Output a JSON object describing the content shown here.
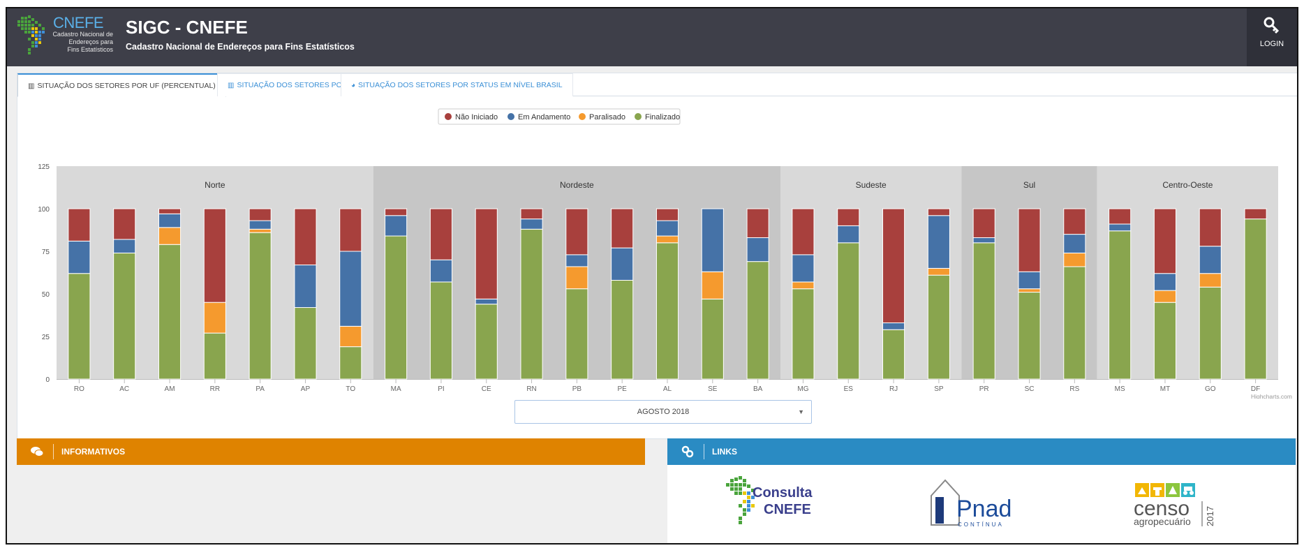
{
  "header": {
    "logo_word": "CNEFE",
    "logo_sub_lines": [
      "Cadastro Nacional de",
      "Endereços para",
      "Fins Estatísticos"
    ],
    "title": "SIGC - CNEFE",
    "subtitle": "Cadastro Nacional de Endereços para Fins Estatísticos",
    "login_icon": "key-icon",
    "login_label": "LOGIN"
  },
  "tabs": [
    {
      "label": "SITUAÇÃO DOS SETORES POR UF (PERCENTUAL)",
      "icon": "bar-chart-icon",
      "active": true
    },
    {
      "label": "SITUAÇÃO DOS SETORES POR UF",
      "icon": "bar-chart-icon",
      "active": false
    },
    {
      "label": "SITUAÇÃO DOS SETORES POR STATUS EM NÍVEL BRASIL",
      "icon": "pie-chart-icon",
      "active": false
    }
  ],
  "chart_data": {
    "type": "bar",
    "stacked": true,
    "categories": [
      "RO",
      "AC",
      "AM",
      "RR",
      "PA",
      "AP",
      "TO",
      "MA",
      "PI",
      "CE",
      "RN",
      "PB",
      "PE",
      "AL",
      "SE",
      "BA",
      "MG",
      "ES",
      "RJ",
      "SP",
      "PR",
      "SC",
      "RS",
      "MS",
      "MT",
      "GO",
      "DF"
    ],
    "regions": [
      {
        "name": "Norte",
        "from": 0,
        "to": 6
      },
      {
        "name": "Nordeste",
        "from": 7,
        "to": 15
      },
      {
        "name": "Sudeste",
        "from": 16,
        "to": 19
      },
      {
        "name": "Sul",
        "from": 20,
        "to": 22
      },
      {
        "name": "Centro-Oeste",
        "from": 23,
        "to": 26
      }
    ],
    "series": [
      {
        "name": "Não Iniciado",
        "color": "#a8403d",
        "values": [
          19,
          18,
          3,
          55,
          7,
          33,
          25,
          4,
          30,
          53,
          6,
          27,
          23,
          7,
          0,
          17,
          27,
          10,
          67,
          4,
          17,
          37,
          15,
          9,
          38,
          22,
          6
        ]
      },
      {
        "name": "Em Andamento",
        "color": "#4572a7",
        "values": [
          19,
          8,
          8,
          0,
          5,
          25,
          44,
          12,
          13,
          3,
          6,
          7,
          19,
          9,
          37,
          14,
          16,
          10,
          4,
          31,
          3,
          10,
          11,
          4,
          10,
          16,
          0
        ]
      },
      {
        "name": "Paralisado",
        "color": "#f59a2e",
        "values": [
          0,
          0,
          10,
          18,
          2,
          0,
          12,
          0,
          0,
          0,
          0,
          13,
          0,
          4,
          16,
          0,
          4,
          0,
          0,
          4,
          0,
          2,
          8,
          0,
          7,
          8,
          0
        ]
      },
      {
        "name": "Finalizado",
        "color": "#89a54e",
        "values": [
          62,
          74,
          79,
          27,
          86,
          42,
          19,
          84,
          57,
          44,
          88,
          53,
          58,
          80,
          47,
          69,
          53,
          80,
          29,
          61,
          80,
          51,
          66,
          87,
          45,
          54,
          94
        ]
      }
    ],
    "ylim": [
      0,
      125
    ],
    "yticks": [
      0,
      25,
      50,
      75,
      100,
      125
    ],
    "legend_position": "top-center",
    "credits": "Highcharts.com",
    "band_colors": [
      "#d9d9d9",
      "#c6c6c6"
    ]
  },
  "month_select": {
    "value": "AGOSTO 2018"
  },
  "info_box": {
    "icon": "comments-icon",
    "label": "INFORMATIVOS"
  },
  "links_box": {
    "icon": "link-icon",
    "label": "LINKS",
    "logos": [
      {
        "word1": "Consulta",
        "word2": "CNEFE"
      },
      {
        "word1": "Pnad",
        "word2": "CONTÍNUA"
      },
      {
        "word1": "censo",
        "word2": "agropecuário",
        "year": "2017"
      }
    ]
  }
}
